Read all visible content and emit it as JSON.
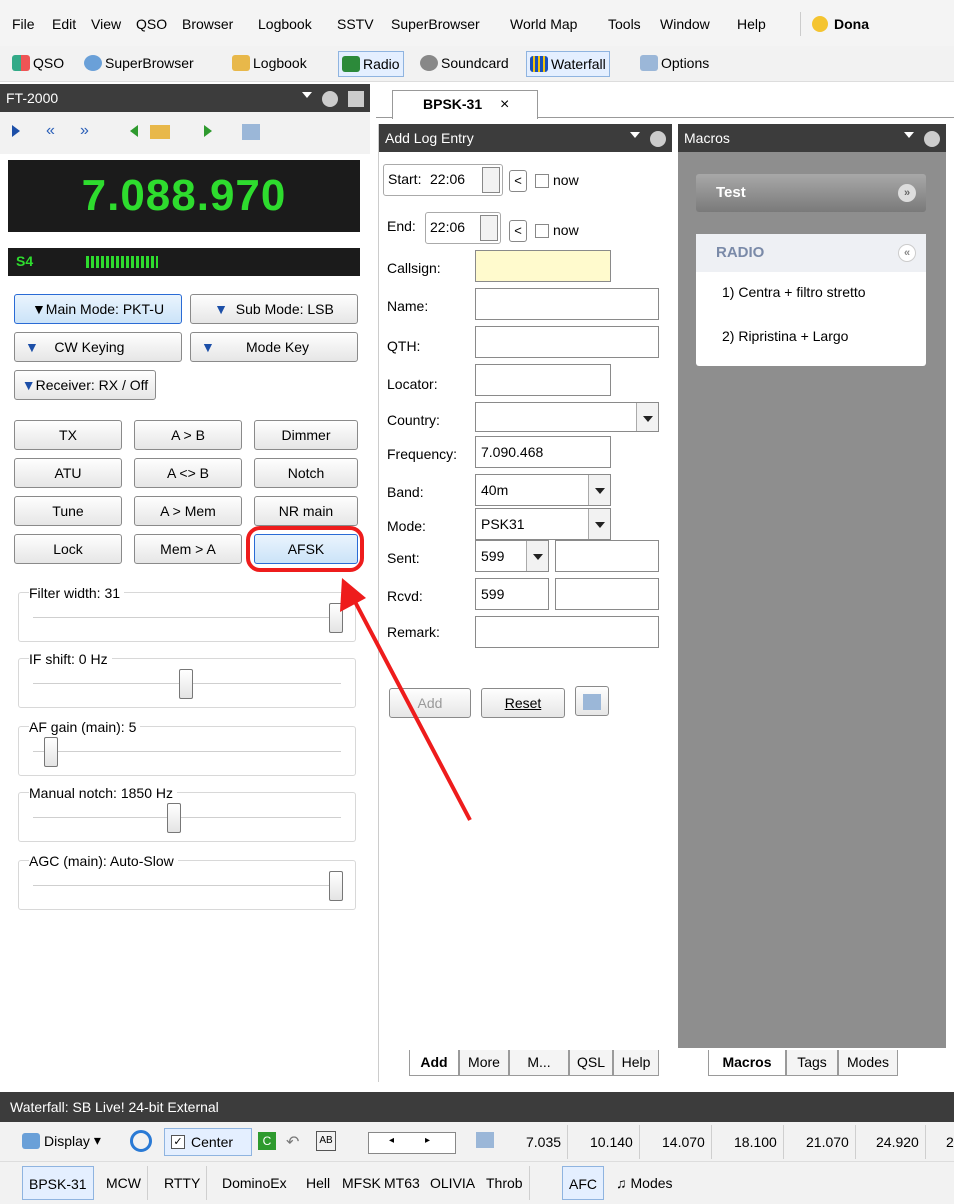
{
  "menu": {
    "items": [
      "File",
      "Edit",
      "View",
      "QSO",
      "Browser",
      "Logbook",
      "SSTV",
      "SuperBrowser",
      "World Map",
      "Tools",
      "Window",
      "Help"
    ],
    "donate": "Dona"
  },
  "toolbar": {
    "items": [
      "QSO",
      "SuperBrowser",
      "Logbook",
      "Radio",
      "Soundcard",
      "Waterfall",
      "Options"
    ]
  },
  "radio_panel": {
    "title": "FT-2000",
    "frequency": "7.088.970",
    "s_meter_label": "S4",
    "s_meter_level": 0.4,
    "mode_buttons": {
      "main_mode": "Main Mode: PKT-U",
      "sub_mode": "Sub Mode: LSB",
      "cw_keying": "CW Keying",
      "mode_key": "Mode Key",
      "receiver": "Receiver: RX / Off"
    },
    "grid_buttons": [
      "TX",
      "A > B",
      "Dimmer",
      "ATU",
      "A <> B",
      "Notch",
      "Tune",
      "A > Mem",
      "NR main",
      "Lock",
      "Mem > A",
      "AFSK"
    ],
    "sliders": [
      {
        "label": "Filter width: 31",
        "value": 1.0
      },
      {
        "label": "IF shift: 0 Hz",
        "value": 0.5
      },
      {
        "label": "AF gain (main): 5",
        "value": 0.05
      },
      {
        "label": "Manual notch: 1850 Hz",
        "value": 0.46
      },
      {
        "label": "AGC (main): Auto-Slow",
        "value": 1.0
      }
    ]
  },
  "doc_tab": {
    "label": "BPSK-31",
    "close": "×"
  },
  "log_entry": {
    "title": "Add Log Entry",
    "start_label": "Start:",
    "start_value": "22:06",
    "end_label": "End:",
    "end_value": "22:06",
    "now_label": "now",
    "lt_label": "<",
    "labels": {
      "callsign": "Callsign:",
      "name": "Name:",
      "qth": "QTH:",
      "locator": "Locator:",
      "country": "Country:",
      "frequency": "Frequency:",
      "band": "Band:",
      "mode": "Mode:",
      "sent": "Sent:",
      "rcvd": "Rcvd:",
      "remark": "Remark:"
    },
    "values": {
      "frequency": "7.090.468",
      "band": "40m",
      "mode": "PSK31",
      "sent": "599",
      "rcvd": "599"
    },
    "add_button": "Add",
    "reset_button": "Reset",
    "tabs": [
      "Add",
      "More",
      "M...",
      "QSL",
      "Help"
    ]
  },
  "macros": {
    "title": "Macros",
    "groups": [
      {
        "title": "Test"
      },
      {
        "title": "RADIO"
      }
    ],
    "items": [
      "1) Centra + filtro stretto",
      "2) Ripristina + Largo"
    ],
    "tabs": [
      "Macros",
      "Tags",
      "Modes"
    ]
  },
  "waterfall": {
    "title": "Waterfall: SB Live! 24-bit External",
    "display_label": "Display",
    "center_label": "Center",
    "c_label": "C",
    "ab_label": "AB",
    "freqs": [
      "7.035",
      "10.140",
      "14.070",
      "18.100",
      "21.070",
      "24.920",
      "2"
    ],
    "modes": [
      "BPSK-31",
      "MCW",
      "RTTY",
      "DominoEx",
      "Hell",
      "MFSK",
      "MT63",
      "OLIVIA",
      "Throb"
    ],
    "afc_label": "AFC",
    "modes_label": "Modes"
  },
  "colors": {
    "frequency_display": "#2edc2e",
    "s_meter": "#2edc2e",
    "callsign_bg": "#fffacd",
    "highlight": "#ee1c1c"
  }
}
